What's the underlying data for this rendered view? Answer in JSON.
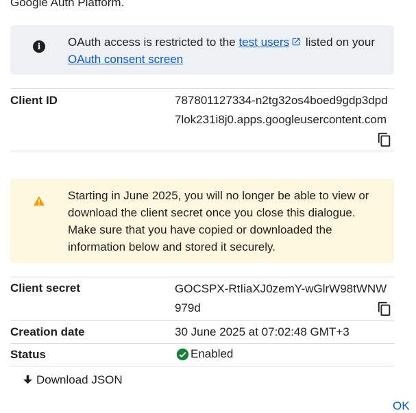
{
  "header_text": "Google Auth Platform.",
  "info_banner": {
    "icon": "info-icon",
    "text_before": "OAuth access is restricted to the ",
    "test_users_link": "test users",
    "text_middle": " listed on your ",
    "consent_link": "OAuth consent screen"
  },
  "client_id": {
    "label": "Client ID",
    "value": "787801127334-n2tg32os4boed9gdp3dpd7lok231i8j0.apps.googleusercontent.com",
    "copy_icon": "copy-icon"
  },
  "warning_banner": {
    "icon": "warning-icon",
    "text": "Starting in June 2025, you will no longer be able to view or download the client secret once you close this dialogue. Make sure that you have copied or downloaded the information below and stored it securely."
  },
  "client_secret": {
    "label": "Client secret",
    "value": "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",
    "copy_icon": "copy-icon"
  },
  "creation_date": {
    "label": "Creation date",
    "value": "30 June 2025 at 07:02:48 GMT+3"
  },
  "status": {
    "label": "Status",
    "value": "Enabled",
    "icon": "check-circle-icon",
    "color": "#188038"
  },
  "download_button": {
    "label": "Download JSON",
    "icon": "download-icon"
  },
  "ok_button": {
    "label": "OK"
  },
  "colors": {
    "link": "#0b57d0",
    "info_bg": "#eef1f4",
    "warn_bg": "#fef7e0",
    "warn_icon": "#f29900"
  }
}
